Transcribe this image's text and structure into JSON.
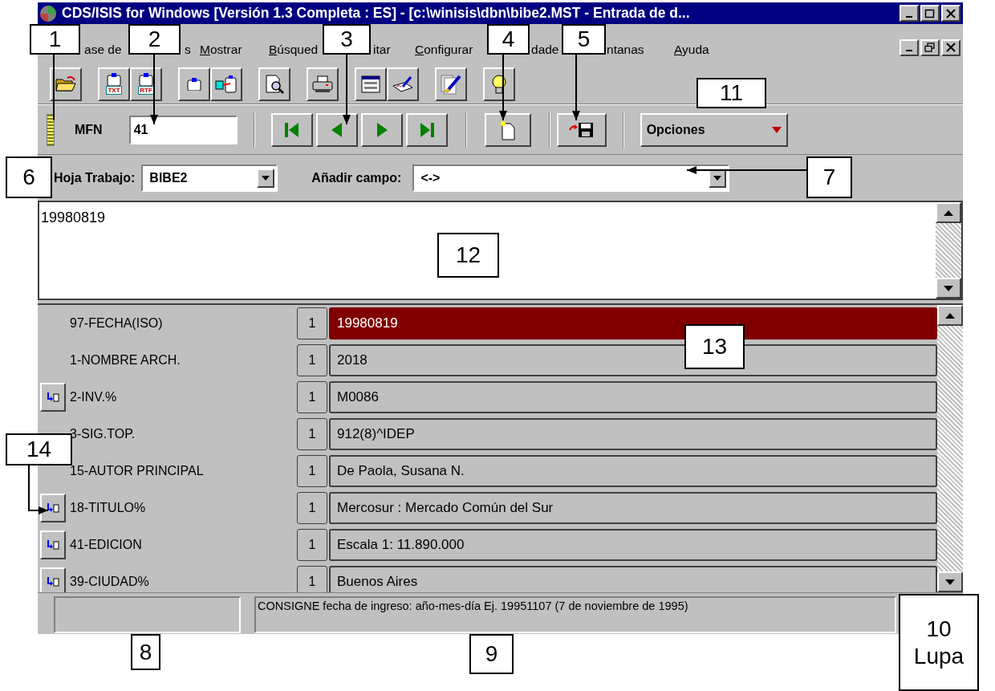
{
  "window": {
    "title": "CDS/ISIS for Windows [Versión 1.3 Completa : ES] - [c:\\winisis\\dbn\\bibe2.MST - Entrada de d..."
  },
  "menu": [
    {
      "label": "ase de",
      "accel": false
    },
    {
      "label": "s",
      "accel": false
    },
    {
      "label": "Mostrar",
      "accel": true
    },
    {
      "label": "Búsqued",
      "accel": true
    },
    {
      "label": "itar",
      "accel": false
    },
    {
      "label": "Configurar",
      "accel": true
    },
    {
      "label": "dade",
      "accel": false
    },
    {
      "label": "ntanas",
      "accel": false
    },
    {
      "label": "Ayuda",
      "accel": true
    }
  ],
  "export_labels": [
    "TXT",
    "RTF"
  ],
  "record": {
    "mfn_label": "MFN",
    "mfn": "41",
    "options_button": "Opciones"
  },
  "worksheet": {
    "label": "Hoja Trabajo:",
    "value": "BIBE2"
  },
  "add_field": {
    "label": "Añadir campo:",
    "value": "<->"
  },
  "editor": {
    "value": "19980819"
  },
  "fields": [
    {
      "tag": "97-FECHA(ISO)",
      "occurrence": "1",
      "value": "19980819",
      "selected": true,
      "has_button": false
    },
    {
      "tag": "1-NOMBRE ARCH.",
      "occurrence": "1",
      "value": "2018",
      "selected": false,
      "has_button": false
    },
    {
      "tag": "2-INV.%",
      "occurrence": "1",
      "value": "M0086",
      "selected": false,
      "has_button": true
    },
    {
      "tag": "3-SIG.TOP.",
      "occurrence": "1",
      "value": "912(8)^IDEP",
      "selected": false,
      "has_button": false
    },
    {
      "tag": "15-AUTOR PRINCIPAL",
      "occurrence": "1",
      "value": "De Paola, Susana N.",
      "selected": false,
      "has_button": false
    },
    {
      "tag": "18-TITULO%",
      "occurrence": "1",
      "value": "Mercosur : Mercado Común del Sur",
      "selected": false,
      "has_button": true
    },
    {
      "tag": "41-EDICION",
      "occurrence": "1",
      "value": "Escala 1: 11.890.000",
      "selected": false,
      "has_button": true
    },
    {
      "tag": "39-CIUDAD%",
      "occurrence": "1",
      "value": "Buenos Aires",
      "selected": false,
      "has_button": true
    }
  ],
  "status_bar": {
    "message": "CONSIGNE fecha de ingreso: año-mes-día  Ej. 19951107 (7 de noviembre de 1995)"
  },
  "callouts": [
    {
      "number": "1"
    },
    {
      "number": "2"
    },
    {
      "number": "3"
    },
    {
      "number": "4"
    },
    {
      "number": "5"
    },
    {
      "number": "11"
    },
    {
      "number": "6"
    },
    {
      "number": "7"
    },
    {
      "number": "12"
    },
    {
      "number": "13"
    },
    {
      "number": "14"
    },
    {
      "number": "8"
    },
    {
      "number": "9"
    },
    {
      "number": "10",
      "caption": "Lupa"
    }
  ]
}
